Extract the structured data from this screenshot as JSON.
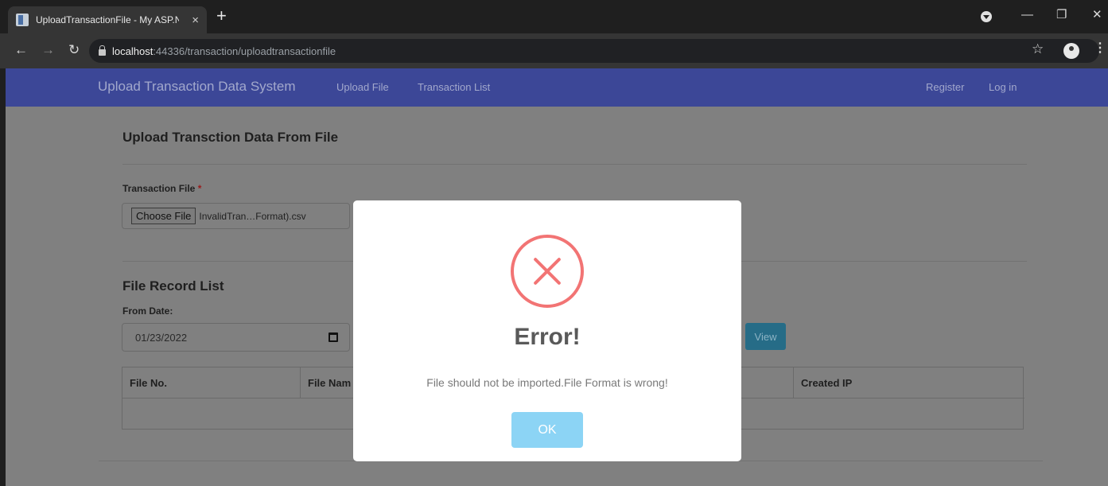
{
  "browser": {
    "tab_title": "UploadTransactionFile - My ASP.N",
    "new_tab": "+",
    "tab_close": "×",
    "url_host": "localhost",
    "url_path": ":44336/transaction/uploadtransactionfile",
    "icons": [
      "page-favicon",
      "back-arrow",
      "forward-arrow",
      "reload",
      "lock",
      "star",
      "profile",
      "menu-kebab",
      "minimize",
      "restore",
      "close"
    ]
  },
  "site": {
    "brand": "Upload Transaction Data System",
    "nav": [
      "Upload File",
      "Transaction List"
    ],
    "auth": [
      "Register",
      "Log in"
    ],
    "header_color": "#3f51b5"
  },
  "upload": {
    "title": "Upload Transction Data From File",
    "field_label": "Transaction File",
    "required_mark": "*",
    "choose_button": "Choose File",
    "file_name": "InvalidTran…Format).csv"
  },
  "records": {
    "title": "File Record List",
    "from_label": "From Date:",
    "from_value": "01/23/2022",
    "view_button": "View",
    "columns": [
      "File No.",
      "File Nam",
      "Created IP"
    ]
  },
  "dialog": {
    "icon": "error-x",
    "title": "Error!",
    "message": "File should not be imported.File Format is wrong!",
    "ok_button": "OK",
    "accent_color": "#f27474",
    "button_color": "#8cd4f5"
  }
}
